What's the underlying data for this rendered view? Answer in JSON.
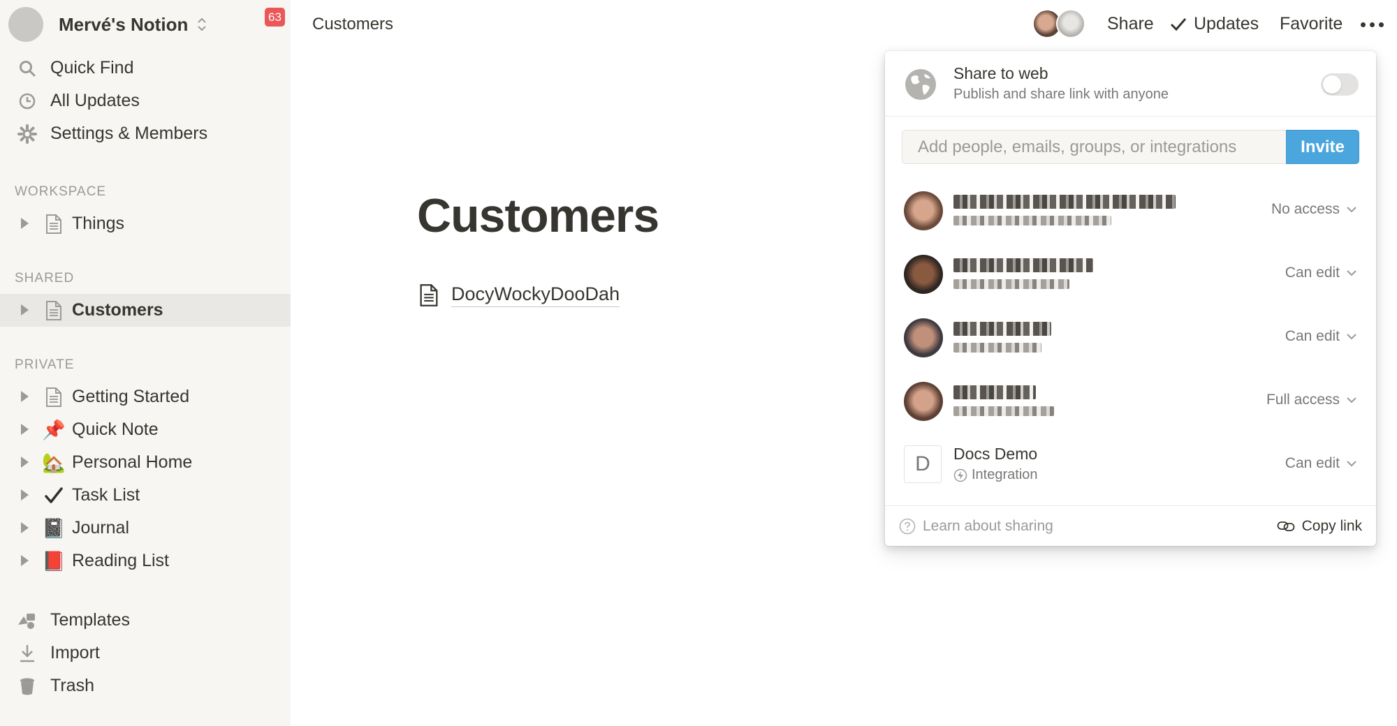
{
  "workspace": {
    "name": "Mervé's Notion",
    "notification_count": "63"
  },
  "sidebar": {
    "nav": [
      {
        "label": "Quick Find",
        "icon": "search-icon"
      },
      {
        "label": "All Updates",
        "icon": "clock-icon"
      },
      {
        "label": "Settings & Members",
        "icon": "gear-icon"
      }
    ],
    "sections": {
      "workspace": "WORKSPACE",
      "shared": "SHARED",
      "private": "PRIVATE"
    },
    "workspace_pages": [
      {
        "label": "Things",
        "icon": "page-icon"
      }
    ],
    "shared_pages": [
      {
        "label": "Customers",
        "icon": "page-icon",
        "active": true
      }
    ],
    "private_pages": [
      {
        "label": "Getting Started",
        "icon": "page-icon"
      },
      {
        "label": "Quick Note",
        "icon": "📌"
      },
      {
        "label": "Personal Home",
        "icon": "🏡"
      },
      {
        "label": "Task List",
        "icon": "✔️"
      },
      {
        "label": "Journal",
        "icon": "📓"
      },
      {
        "label": "Reading List",
        "icon": "📕"
      }
    ],
    "bottom": [
      {
        "label": "Templates",
        "icon": "templates-icon"
      },
      {
        "label": "Import",
        "icon": "download-icon"
      },
      {
        "label": "Trash",
        "icon": "trash-icon"
      }
    ]
  },
  "topbar": {
    "breadcrumb": "Customers",
    "share": "Share",
    "updates": "Updates",
    "favorite": "Favorite"
  },
  "page": {
    "title": "Customers",
    "subpage": "DocyWockyDooDah"
  },
  "share_panel": {
    "web_title": "Share to web",
    "web_subtitle": "Publish and share link with anyone",
    "web_enabled": false,
    "invite_placeholder": "Add people, emails, groups, or integrations",
    "invite_button": "Invite",
    "members": [
      {
        "access": "No access"
      },
      {
        "access": "Can edit"
      },
      {
        "access": "Can edit"
      },
      {
        "access": "Full access"
      }
    ],
    "integration": {
      "initial": "D",
      "name": "Docs Demo",
      "type": "Integration",
      "access": "Can edit"
    },
    "learn": "Learn about sharing",
    "copy_link": "Copy link"
  },
  "colors": {
    "sidebar_bg": "#f7f6f3",
    "badge": "#eb5757",
    "invite_button": "#4ba6de",
    "text": "#37352f",
    "muted": "#9b9a97"
  }
}
